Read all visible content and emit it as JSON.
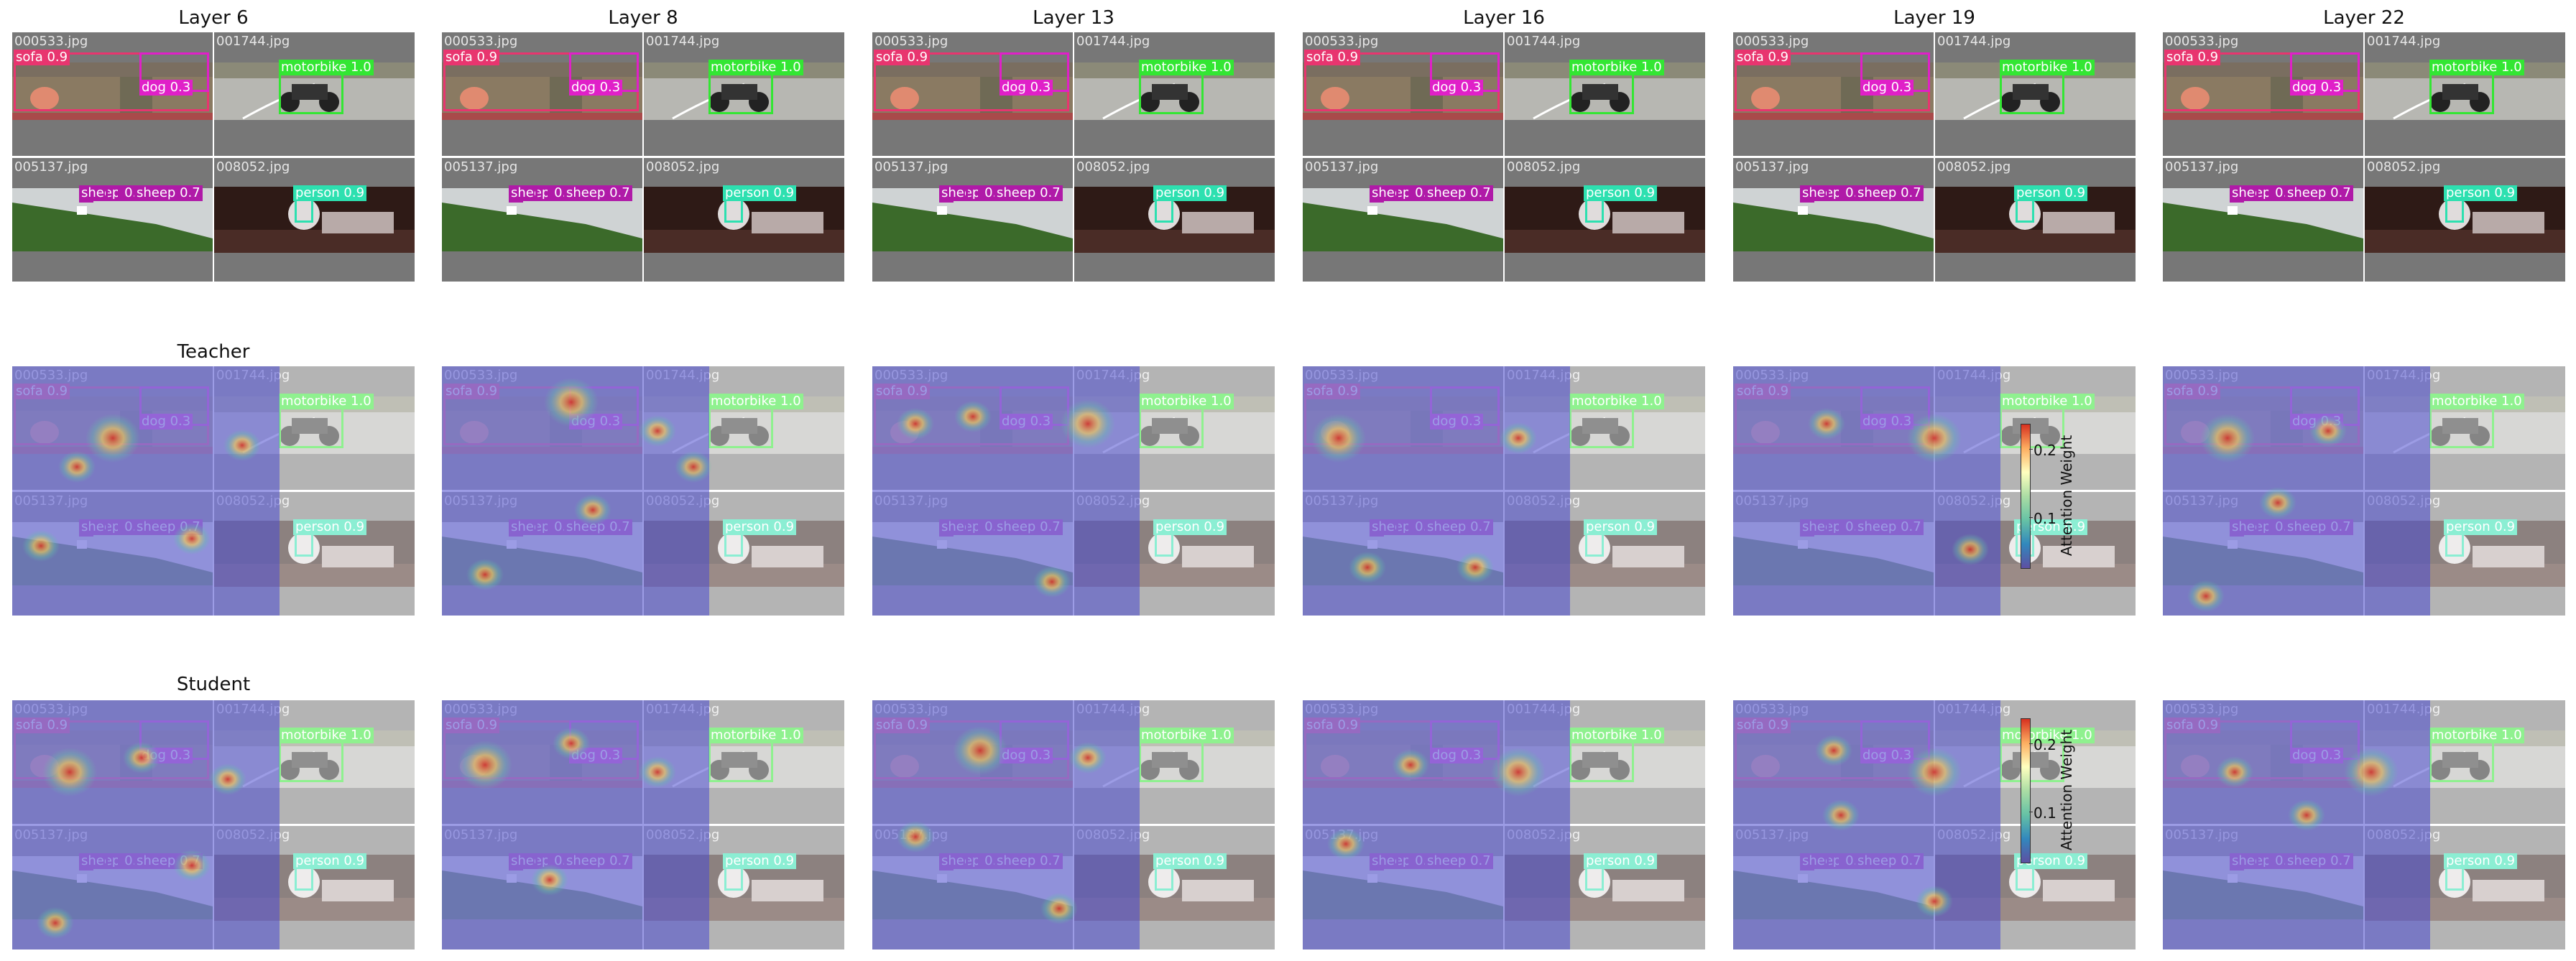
{
  "columns": [
    "Layer 6",
    "Layer 8",
    "Layer 13",
    "Layer 16",
    "Layer 19",
    "Layer 22"
  ],
  "row_titles": [
    "",
    "Teacher",
    "Student"
  ],
  "images": [
    {
      "file": "000533.jpg",
      "detections": [
        {
          "label": "sofa 0.9",
          "color": "#e8356f"
        },
        {
          "label": "dog 0.3",
          "color": "#e020c8"
        }
      ]
    },
    {
      "file": "001744.jpg",
      "detections": [
        {
          "label": "motorbike 1.0",
          "color": "#33e633"
        }
      ]
    },
    {
      "file": "005137.jpg",
      "detections": [
        {
          "label": "sheep 0.3",
          "color": "#b01aa8"
        },
        {
          "label": "sheep 0.7",
          "color": "#b01aa8"
        }
      ]
    },
    {
      "file": "008052.jpg",
      "detections": [
        {
          "label": "person 0.9",
          "color": "#2de0b0"
        }
      ]
    }
  ],
  "colorbar": {
    "label": "Attention Weight",
    "ticks": [
      "0.2",
      "0.1"
    ]
  },
  "colors": {
    "attention_low": "#4a4ad0",
    "attention_high": "#d7301f",
    "background": "#777777"
  }
}
